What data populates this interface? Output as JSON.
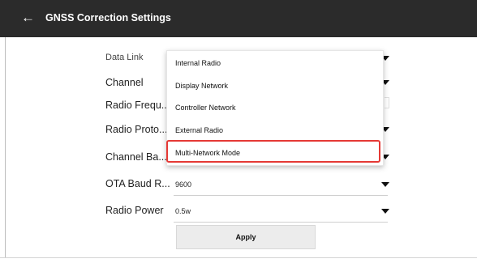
{
  "header": {
    "back_glyph": "←",
    "title": "GNSS Correction Settings"
  },
  "form": {
    "rows": [
      {
        "label": "Data Link",
        "value": ""
      },
      {
        "label": "Channel",
        "value": ""
      },
      {
        "label": "Radio Frequ...",
        "value": ""
      },
      {
        "label": "Radio Proto...",
        "value": ""
      },
      {
        "label": "Channel Ba...",
        "value": ""
      },
      {
        "label": "OTA Baud R...",
        "value": "9600"
      },
      {
        "label": "Radio Power",
        "value": "0.5w"
      }
    ],
    "apply_label": "Apply"
  },
  "dropdown": {
    "options": [
      "Internal Radio",
      "Display Network",
      "Controller Network",
      "External Radio",
      "Multi-Network Mode"
    ],
    "highlighted": "Multi-Network Mode"
  },
  "colors": {
    "titlebar": "#2b2b2b",
    "highlight": "#e53935"
  }
}
